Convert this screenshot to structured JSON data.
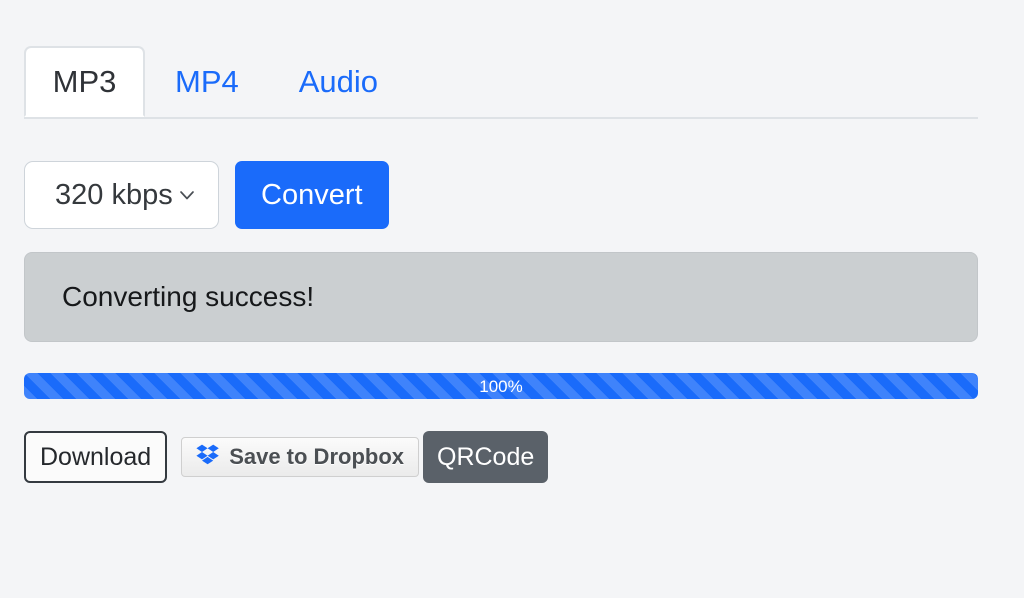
{
  "theme": {
    "page_background": "#f4f5f7",
    "accent_blue": "#1a6bfa",
    "status_background": "#cbcfd1",
    "qrcode_background": "#5a6169",
    "border_gray": "#dee2e6"
  },
  "tabs": [
    {
      "label": "MP3",
      "active": true
    },
    {
      "label": "MP4",
      "active": false
    },
    {
      "label": "Audio",
      "active": false
    }
  ],
  "controls": {
    "bitrate_select": {
      "value": "320 kbps",
      "icon": "chevron-down-icon"
    },
    "convert_label": "Convert"
  },
  "status": {
    "message": "Converting success!"
  },
  "progress": {
    "percent": 100,
    "label": "100%"
  },
  "actions": {
    "download_label": "Download",
    "dropbox_label": "Save to Dropbox",
    "dropbox_icon": "dropbox-icon",
    "qrcode_label": "QRCode"
  }
}
